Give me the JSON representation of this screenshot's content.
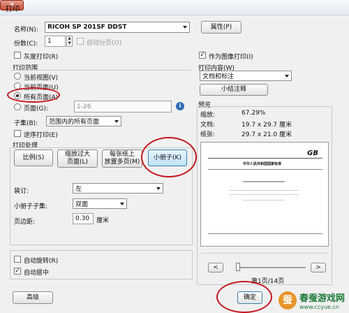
{
  "window": {
    "title": "打印",
    "close_icon": "close-icon"
  },
  "printer": {
    "name_label": "名称(N):",
    "name_value": "RICOH SP 201SF DDST",
    "properties_button": "属性(P)"
  },
  "copies": {
    "label": "份数(C):",
    "value": "1",
    "collate_label": "自动分页(O)"
  },
  "options": {
    "grayscale_label": "灰度打印(R)",
    "print_as_image_label": "作为图像打印(I)"
  },
  "print_range": {
    "section_label": "打印范围",
    "radios": [
      "当前视图(V)",
      "当前页面(U)",
      "所有页面(A)",
      "页面(G):"
    ],
    "pages_value": "1-26",
    "subset_label": "子集(B):",
    "subset_value": "范围内的所有页面",
    "reverse_label": "逆序打印(E)"
  },
  "print_content": {
    "section_label": "打印内容(W)",
    "value": "文档和标注",
    "summarize_button": "小结注释"
  },
  "preview": {
    "section_label": "预览",
    "zoom_label": "缩放:",
    "zoom_value": "67.29%",
    "doc_label": "文档:",
    "doc_value": "19.7 x 29.7 厘米",
    "paper_label": "纸张:",
    "paper_value": "29.7 x 21.0 厘米",
    "doc_logo": "GB",
    "doc_title": "中华人民共和国国家标准",
    "page_indicator": "第1页/14页",
    "prev_button": "<",
    "next_button": ">"
  },
  "page_handling": {
    "section_label": "打印处理",
    "buttons": [
      "比例(S)",
      "缩放过大\n页面(L)",
      "每张纸上\n放置多页(M)",
      "小册子(K)"
    ],
    "binding_label": "装订:",
    "binding_value": "左",
    "booklet_subset_label": "小册子子集:",
    "booklet_subset_value": "双面",
    "margin_label": "页边距:",
    "margin_value": "0.30",
    "margin_unit": "厘米"
  },
  "bottom": {
    "auto_rotate_label": "自动旋转(R)",
    "auto_center_label": "自动居中",
    "advanced_button": "高级",
    "ok_button": "确定"
  },
  "watermark": {
    "text": "春蚕游戏网",
    "url": "www.ccyue.cn"
  },
  "colors": {
    "annotation_red": "#c4161c",
    "selected_blue": "#3c7fb1"
  }
}
